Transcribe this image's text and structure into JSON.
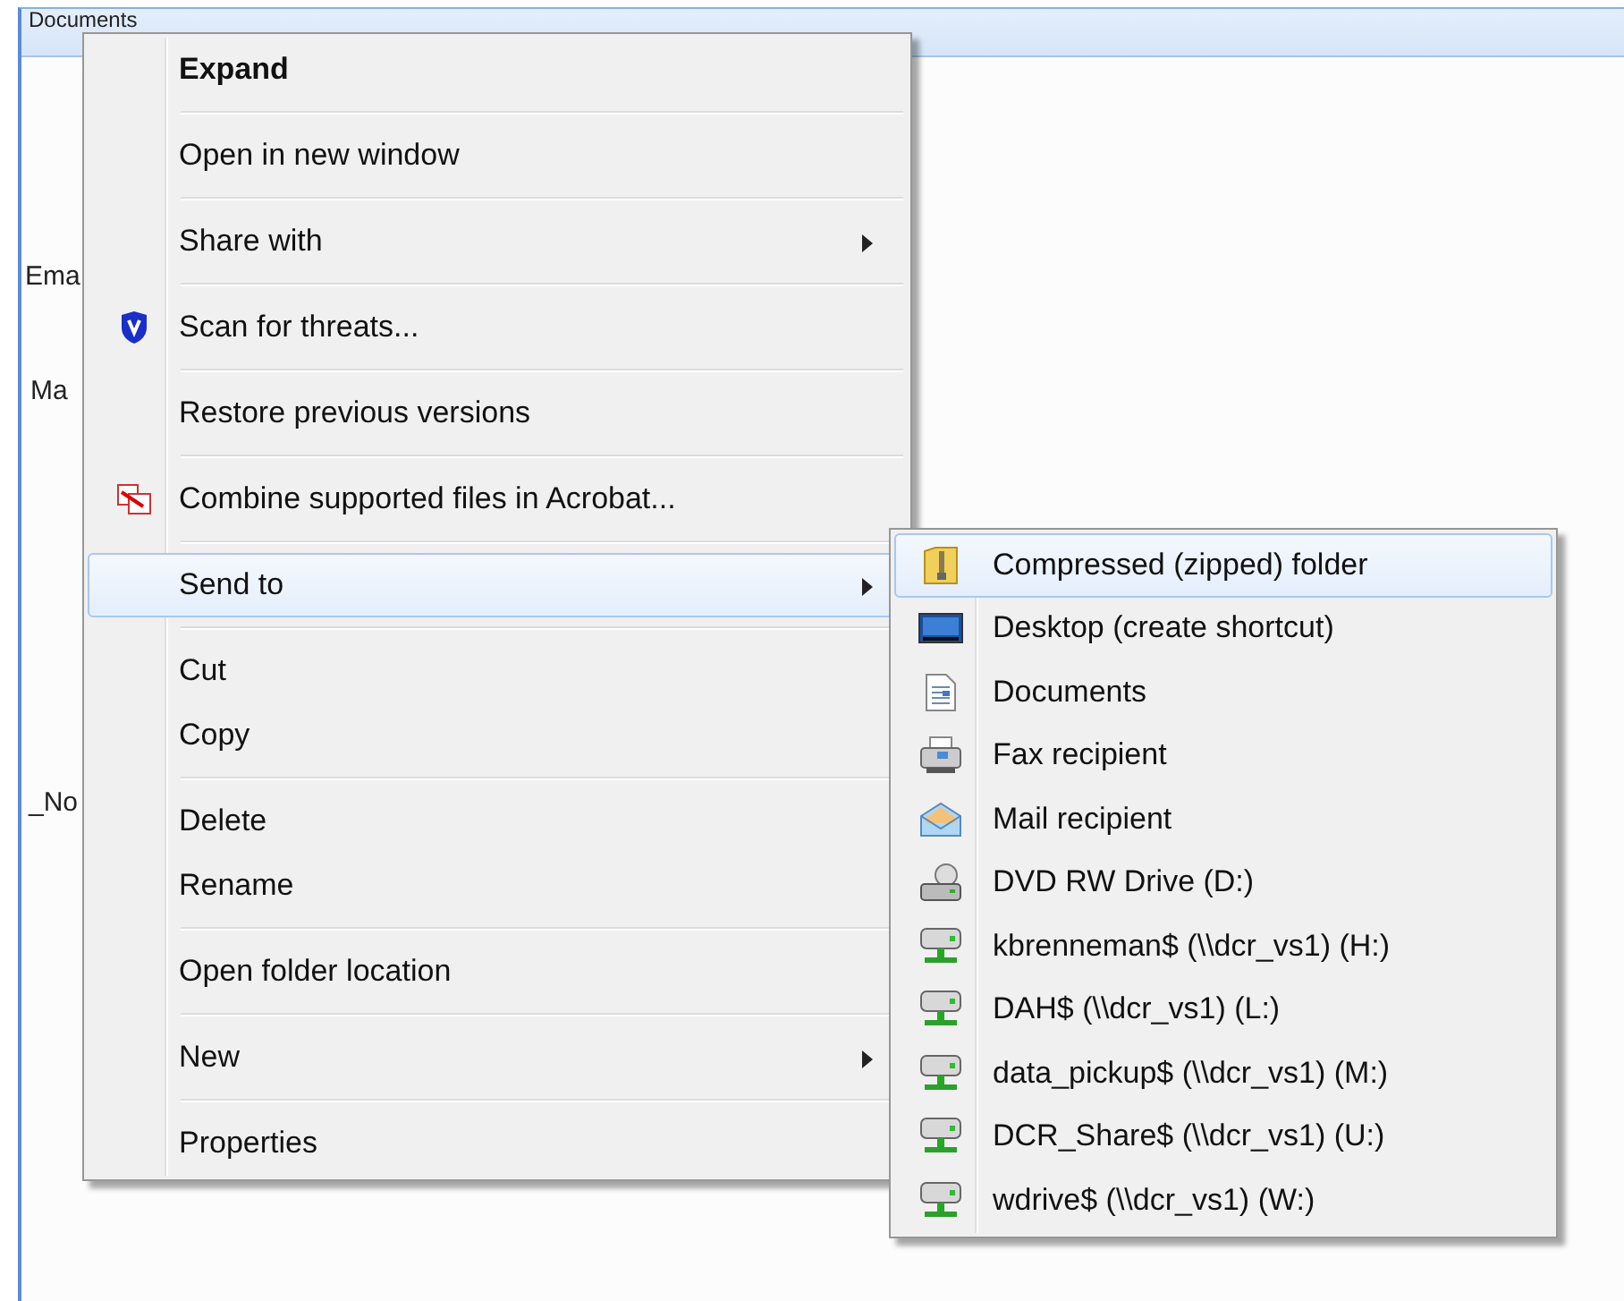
{
  "window": {
    "title": "Documents",
    "partial_labels": [
      "Ema",
      "Ma",
      "_No"
    ]
  },
  "context_menu": {
    "groups": [
      [
        {
          "label": "Expand",
          "bold": true,
          "submenu": false,
          "selected": false
        }
      ],
      [
        {
          "label": "Open in new window",
          "bold": false,
          "submenu": false,
          "selected": false
        }
      ],
      [
        {
          "label": "Share with",
          "bold": false,
          "submenu": true,
          "selected": false
        }
      ],
      [
        {
          "label": "Scan for threats...",
          "bold": false,
          "submenu": false,
          "selected": false
        }
      ],
      [
        {
          "label": "Restore previous versions",
          "bold": false,
          "submenu": false,
          "selected": false
        }
      ],
      [
        {
          "label": "Combine supported files in Acrobat...",
          "bold": false,
          "submenu": false,
          "selected": false
        }
      ],
      [
        {
          "label": "Send to",
          "bold": false,
          "submenu": true,
          "selected": true
        }
      ],
      [
        {
          "label": "Cut",
          "bold": false,
          "submenu": false,
          "selected": false
        },
        {
          "label": "Copy",
          "bold": false,
          "submenu": false,
          "selected": false
        }
      ],
      [
        {
          "label": "Delete",
          "bold": false,
          "submenu": false,
          "selected": false
        },
        {
          "label": "Rename",
          "bold": false,
          "submenu": false,
          "selected": false
        }
      ],
      [
        {
          "label": "Open folder location",
          "bold": false,
          "submenu": false,
          "selected": false
        }
      ],
      [
        {
          "label": "New",
          "bold": false,
          "submenu": true,
          "selected": false
        }
      ],
      [
        {
          "label": "Properties",
          "bold": false,
          "submenu": false,
          "selected": false
        }
      ]
    ]
  },
  "send_to_menu": {
    "items": [
      {
        "label": "Compressed (zipped) folder",
        "kind": "zip",
        "selected": true
      },
      {
        "label": "Desktop (create shortcut)",
        "kind": "desktop",
        "selected": false
      },
      {
        "label": "Documents",
        "kind": "document",
        "selected": false
      },
      {
        "label": "Fax recipient",
        "kind": "fax",
        "selected": false
      },
      {
        "label": "Mail recipient",
        "kind": "mail",
        "selected": false
      },
      {
        "label": "DVD RW Drive (D:)",
        "kind": "dvd",
        "selected": false
      },
      {
        "label": "kbrenneman$ (\\\\dcr_vs1) (H:)",
        "kind": "network",
        "selected": false
      },
      {
        "label": "DAH$ (\\\\dcr_vs1) (L:)",
        "kind": "network",
        "selected": false
      },
      {
        "label": "data_pickup$ (\\\\dcr_vs1) (M:)",
        "kind": "network",
        "selected": false
      },
      {
        "label": "DCR_Share$ (\\\\dcr_vs1) (U:)",
        "kind": "network",
        "selected": false
      },
      {
        "label": "wdrive$ (\\\\dcr_vs1) (W:)",
        "kind": "network",
        "selected": false
      }
    ]
  }
}
